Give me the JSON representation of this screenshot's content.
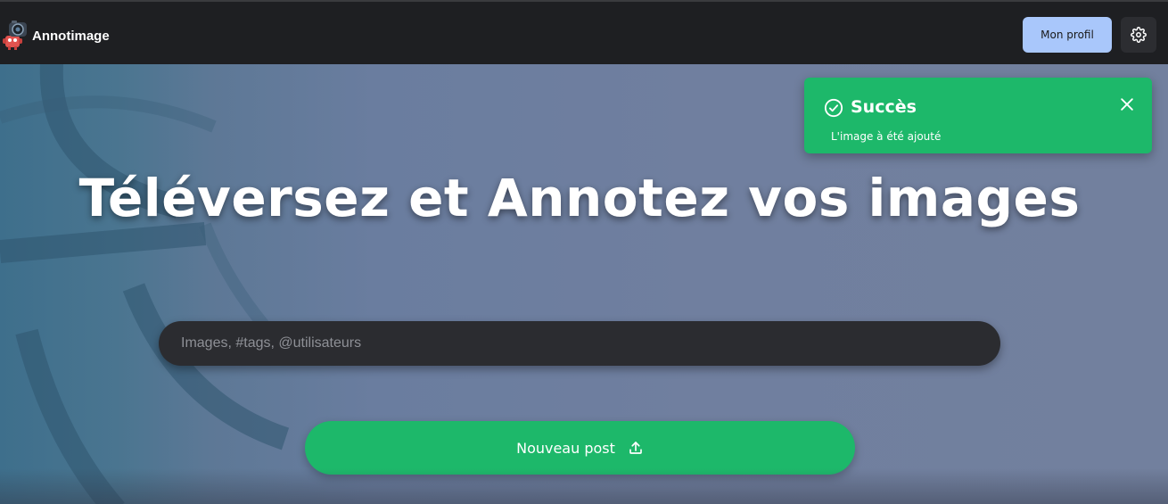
{
  "header": {
    "app_name": "Annotimage",
    "profile_label": "Mon profil",
    "settings_icon": "gear-icon",
    "logo_icon": "camera-robot-logo"
  },
  "hero": {
    "title": "Téléversez et Annotez vos images",
    "search": {
      "placeholder": "Images, #tags, @utilisateurs",
      "value": ""
    },
    "new_post_label": "Nouveau post",
    "new_post_icon": "upload-icon"
  },
  "toast": {
    "title": "Succès",
    "message": "L'image à été ajouté",
    "icon": "check-circle-icon",
    "close_icon": "close-icon"
  },
  "colors": {
    "topbar": "#1e1f22",
    "profile_button": "#a9c7fb",
    "success_green": "#1db86a",
    "search_bg": "#2b2c30"
  }
}
